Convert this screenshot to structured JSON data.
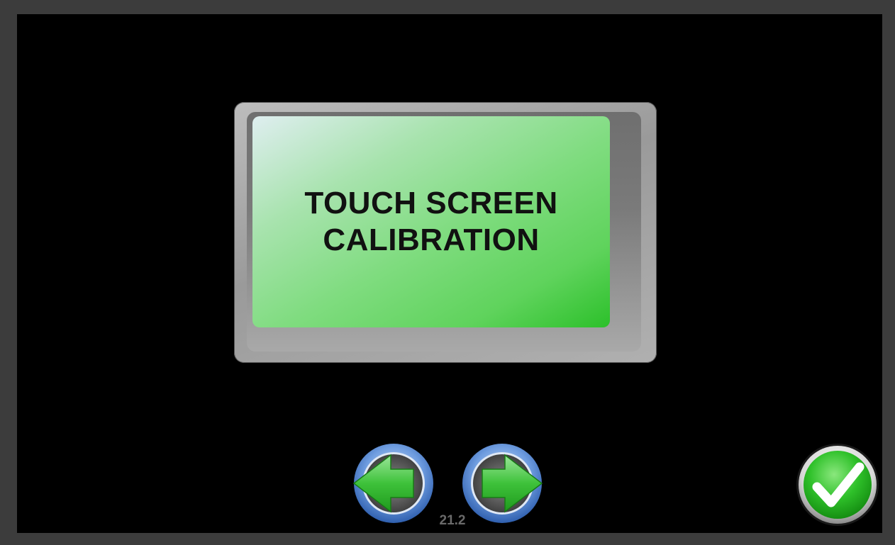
{
  "tile": {
    "line1": "TOUCH SCREEN",
    "line2": "CALIBRATION"
  },
  "navigation": {
    "prev_icon": "left-arrow-icon",
    "next_icon": "right-arrow-icon",
    "page_number": "21.2"
  },
  "confirm": {
    "icon": "checkmark-icon"
  },
  "colors": {
    "panel_green": "#5fd35c",
    "button_blue": "#5b8fd6",
    "arrow_green": "#3fbf3a",
    "background": "#000000"
  }
}
